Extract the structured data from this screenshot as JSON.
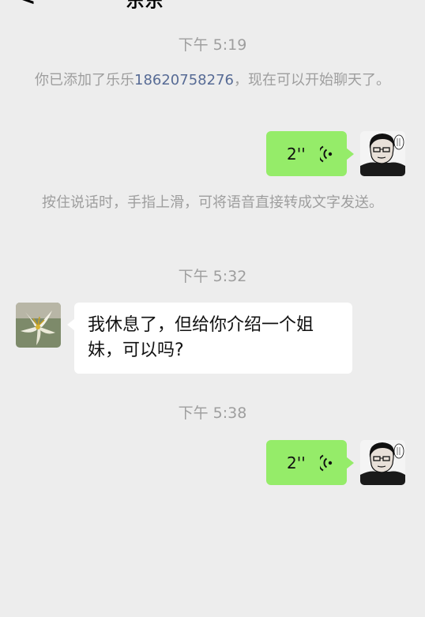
{
  "header": {
    "back_glyph": "<",
    "title_fragment": "乐乐"
  },
  "messages": {
    "ts1": "下午 5:19",
    "added_note": {
      "prefix": "你已添加了乐乐",
      "phone": "18620758276",
      "suffix": "，现在可以开始聊天了。"
    },
    "voice1": {
      "duration": "2''"
    },
    "tip_note": "按住说话时，手指上滑，可将语音直接转成文字发送。",
    "ts2": "下午 5:32",
    "incoming_text": "我休息了，但给你介绍一个姐妹，可以吗?",
    "ts3": "下午 5:38",
    "voice2": {
      "duration": "2''"
    }
  },
  "icons": {
    "self_avatar": "comic-man-avatar-icon",
    "contact_avatar": "lily-flower-avatar-icon",
    "voice": "voice-wave-icon"
  },
  "colors": {
    "background": "#ededed",
    "outgoing_bubble": "#95ec69",
    "incoming_bubble": "#ffffff",
    "link": "#576b95",
    "meta_text": "#9e9e9e"
  }
}
